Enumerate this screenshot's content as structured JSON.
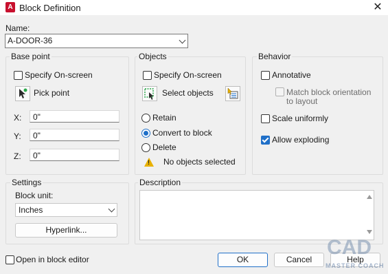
{
  "window": {
    "title": "Block Definition",
    "app_icon_letter": "A"
  },
  "name": {
    "label": "Name:",
    "value": "A-DOOR-36"
  },
  "base_point": {
    "title": "Base point",
    "specify_on_screen": {
      "label": "Specify On-screen",
      "checked": false
    },
    "pick_point": "Pick point",
    "x": {
      "label": "X:",
      "value": "0\""
    },
    "y": {
      "label": "Y:",
      "value": "0\""
    },
    "z": {
      "label": "Z:",
      "value": "0\""
    }
  },
  "objects": {
    "title": "Objects",
    "specify_on_screen": {
      "label": "Specify On-screen",
      "checked": false
    },
    "select_objects": "Select objects",
    "retain": "Retain",
    "convert_to_block": "Convert to block",
    "delete": "Delete",
    "selected_option": "convert_to_block",
    "status": "No objects selected"
  },
  "behavior": {
    "title": "Behavior",
    "annotative": {
      "label": "Annotative",
      "checked": false
    },
    "match_orientation": {
      "label_line1": "Match block orientation",
      "label_line2": "to layout",
      "checked": false,
      "disabled": true
    },
    "scale_uniformly": {
      "label": "Scale uniformly",
      "checked": false
    },
    "allow_exploding": {
      "label": "Allow exploding",
      "checked": true
    }
  },
  "settings": {
    "title": "Settings",
    "block_unit_label": "Block unit:",
    "block_unit_value": "Inches",
    "hyperlink_button": "Hyperlink..."
  },
  "description": {
    "title": "Description",
    "value": ""
  },
  "footer": {
    "open_in_block_editor": {
      "label": "Open in block editor",
      "checked": false
    },
    "ok": "OK",
    "cancel": "Cancel",
    "help": "Help"
  },
  "watermark": {
    "logo": "CAD",
    "text": "MASTER COACH"
  },
  "colors": {
    "accent": "#1f6fc8",
    "warning": "#e8b100",
    "app_icon": "#c8102e"
  }
}
